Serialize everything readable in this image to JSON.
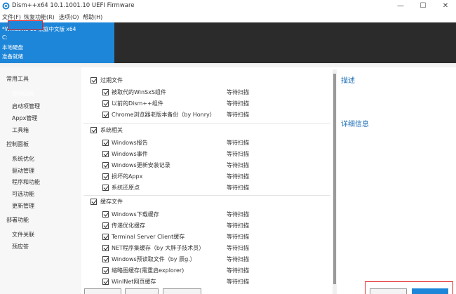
{
  "window": {
    "title": "Dism++x64 10.1.1001.10 UEFI Firmware",
    "minimize_glyph": "—",
    "maximize_glyph": "☐",
    "close_glyph": "✕"
  },
  "menu": [
    "文件(F)",
    "恢复功能(R)",
    "选项(O)",
    "帮助(H)"
  ],
  "session": {
    "os_name": "*Windows 10 家庭中文版 x64",
    "drive": "C:",
    "disk_type": "本地硬盘",
    "status": "准备就绪"
  },
  "sidebar": {
    "groups": [
      {
        "label": "常用工具",
        "items": [
          "空间回收",
          "启动项管理",
          "Appx管理",
          "工具箱"
        ]
      },
      {
        "label": "控制面板",
        "items": [
          "系统优化",
          "驱动管理",
          "程序和功能",
          "可选功能",
          "更新管理"
        ]
      },
      {
        "label": "部署功能",
        "items": [
          "文件关联",
          "预应答"
        ]
      }
    ],
    "selected": "空间回收"
  },
  "cleanup": {
    "groups": [
      {
        "label": "过期文件",
        "checked": true,
        "items": [
          {
            "label": "被取代的WinSxS组件",
            "status": "等待扫描",
            "checked": true
          },
          {
            "label": "以前的Dism++组件",
            "status": "等待扫描",
            "checked": true
          },
          {
            "label": "Chrome浏览器老版本备份（by Honry）",
            "status": "等待扫描",
            "checked": true
          }
        ]
      },
      {
        "label": "系统相关",
        "checked": true,
        "items": [
          {
            "label": "Windows报告",
            "status": "等待扫描",
            "checked": true
          },
          {
            "label": "Windows事件",
            "status": "等待扫描",
            "checked": true
          },
          {
            "label": "Windows更新安装记录",
            "status": "等待扫描",
            "checked": true
          },
          {
            "label": "损坏的Appx",
            "status": "等待扫描",
            "checked": true
          },
          {
            "label": "系统还原点",
            "status": "等待扫描",
            "checked": true
          }
        ]
      },
      {
        "label": "缓存文件",
        "checked": true,
        "items": [
          {
            "label": "Windows下载缓存",
            "status": "等待扫描",
            "checked": true
          },
          {
            "label": "传递优化缓存",
            "status": "等待扫描",
            "checked": true
          },
          {
            "label": "Terminal Server Client缓存",
            "status": "等待扫描",
            "checked": true
          },
          {
            "label": "NET程序集缓存（by 大胖子技术员）",
            "status": "等待扫描",
            "checked": true
          },
          {
            "label": "Windows预读取文件（by 辰g.）",
            "status": "等待扫描",
            "checked": true
          },
          {
            "label": "缩略图缓存(需重启explorer)",
            "status": "等待扫描",
            "checked": true
          },
          {
            "label": "WinINet网页缓存",
            "status": "等待扫描",
            "checked": true
          }
        ]
      }
    ]
  },
  "right_panel": {
    "description_heading": "描述",
    "details_heading": "详细信息"
  },
  "colors": {
    "accent": "#1e86d8",
    "header_dark": "#2b2b2b",
    "highlight_box": "#e02020",
    "heading_blue": "#1e6fb8"
  }
}
